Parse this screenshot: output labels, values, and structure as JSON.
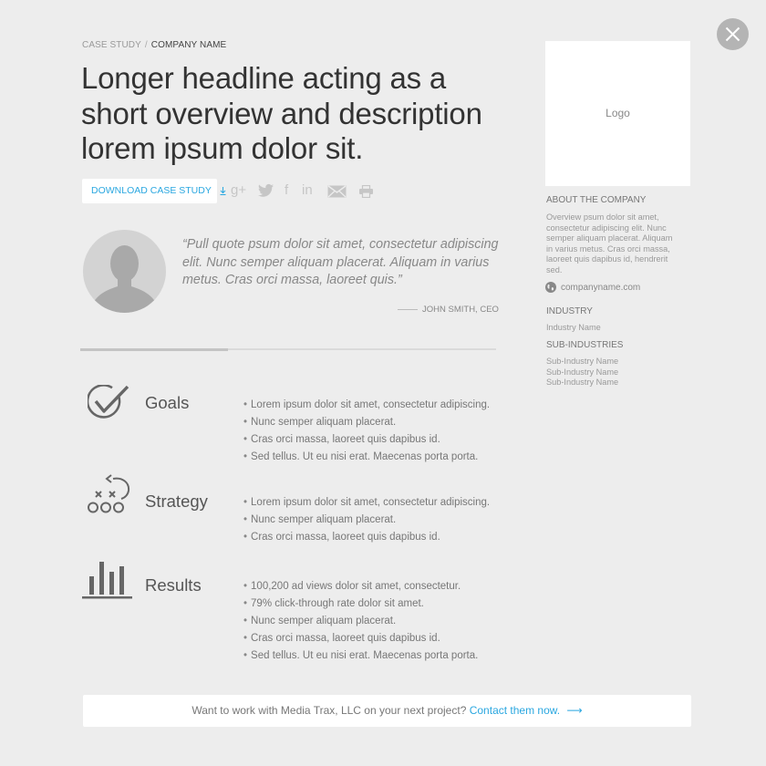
{
  "breadcrumb": {
    "parent": "CASE STUDY",
    "separator": "/",
    "current": "COMPANY NAME"
  },
  "headline": "Longer headline acting as a short overview and description lorem ipsum dolor sit.",
  "download_button": {
    "label": "DOWNLOAD CASE STUDY",
    "icon": "download-icon"
  },
  "share_icons": [
    {
      "name": "google-plus-icon",
      "glyph": "g+"
    },
    {
      "name": "twitter-icon"
    },
    {
      "name": "facebook-icon",
      "glyph": "f"
    },
    {
      "name": "linkedin-icon",
      "glyph": "in"
    },
    {
      "name": "email-icon"
    },
    {
      "name": "print-icon"
    }
  ],
  "quote": {
    "text": "“Pull quote psum dolor sit amet, consectetur adipiscing elit. Nunc semper aliquam placerat. Aliquam in varius metus. Cras orci massa, laoreet quis.”",
    "attribution": "JOHN SMITH, CEO"
  },
  "progress": {
    "fraction": 0.355
  },
  "sections": [
    {
      "title": "Goals",
      "icon": "checkmark-icon",
      "bullets": [
        "Lorem ipsum dolor sit amet, consectetur adipiscing.",
        "Nunc semper aliquam placerat.",
        "Cras orci massa, laoreet quis dapibus id.",
        "Sed tellus. Ut eu nisi erat. Maecenas porta porta."
      ]
    },
    {
      "title": "Strategy",
      "icon": "playbook-icon",
      "bullets": [
        "Lorem ipsum dolor sit amet, consectetur adipiscing.",
        "Nunc semper aliquam placerat.",
        "Cras orci massa, laoreet quis dapibus id."
      ]
    },
    {
      "title": "Results",
      "icon": "bar-chart-icon",
      "bullets": [
        "100,200 ad views  dolor sit amet, consectetur.",
        "79% click-through rate  dolor sit amet.",
        "Nunc semper aliquam placerat.",
        "Cras orci massa, laoreet quis dapibus id.",
        "Sed tellus. Ut eu nisi erat. Maecenas porta porta."
      ]
    }
  ],
  "sidebar": {
    "logo_label": "Logo",
    "about_heading": "ABOUT THE COMPANY",
    "about_text": "Overview psum dolor sit amet, consectetur adipiscing elit. Nunc semper aliquam placerat. Aliquam in varius metus. Cras orci massa, laoreet quis dapibus id, hendrerit sed.",
    "website": "companyname.com",
    "industry_heading": "INDUSTRY",
    "industry_name": "Industry Name",
    "subindustries_heading": "SUB-INDUSTRIES",
    "subindustries": [
      "Sub-Industry Name",
      "Sub-Industry Name",
      "Sub-Industry Name"
    ]
  },
  "cta": {
    "text": "Want to work with Media Trax, LLC on your next project?",
    "link": "Contact them now.",
    "arrow": "⟶"
  },
  "colors": {
    "accent": "#2aa7e0",
    "background": "#ededed",
    "icon_gray": "#666666",
    "close_button": "#b4b4b4"
  }
}
